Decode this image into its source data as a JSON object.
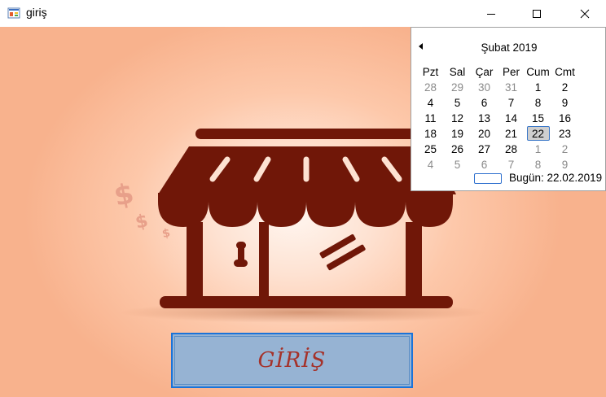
{
  "window": {
    "title": "giriş"
  },
  "login_button": {
    "label": "GİRİŞ"
  },
  "calendar": {
    "month_title": "Şubat 2019",
    "weekdays": [
      "Pzt",
      "Sal",
      "Çar",
      "Per",
      "Cum",
      "Cmt"
    ],
    "weeks": [
      [
        {
          "d": "28",
          "dim": true
        },
        {
          "d": "29",
          "dim": true
        },
        {
          "d": "30",
          "dim": true
        },
        {
          "d": "31",
          "dim": true
        },
        {
          "d": "1"
        },
        {
          "d": "2"
        }
      ],
      [
        {
          "d": "4"
        },
        {
          "d": "5"
        },
        {
          "d": "6"
        },
        {
          "d": "7"
        },
        {
          "d": "8"
        },
        {
          "d": "9"
        }
      ],
      [
        {
          "d": "11"
        },
        {
          "d": "12"
        },
        {
          "d": "13"
        },
        {
          "d": "14"
        },
        {
          "d": "15"
        },
        {
          "d": "16"
        }
      ],
      [
        {
          "d": "18"
        },
        {
          "d": "19"
        },
        {
          "d": "20"
        },
        {
          "d": "21"
        },
        {
          "d": "22",
          "selected": true
        },
        {
          "d": "23"
        }
      ],
      [
        {
          "d": "25"
        },
        {
          "d": "26"
        },
        {
          "d": "27"
        },
        {
          "d": "28"
        },
        {
          "d": "1",
          "dim": true
        },
        {
          "d": "2",
          "dim": true
        }
      ],
      [
        {
          "d": "4",
          "dim": true
        },
        {
          "d": "5",
          "dim": true
        },
        {
          "d": "6",
          "dim": true
        },
        {
          "d": "7",
          "dim": true
        },
        {
          "d": "8",
          "dim": true
        },
        {
          "d": "9",
          "dim": true
        }
      ]
    ],
    "today_label": "Bugün: 22.02.2019"
  },
  "colors": {
    "shop": "#701708",
    "dollar": "#e8a08a",
    "button_fill": "#96b3d3",
    "button_border": "#1a73d9",
    "button_text": "#a5322a"
  },
  "icons": [
    "app-icon",
    "minimize-icon",
    "maximize-icon",
    "close-icon",
    "prev-month-icon",
    "store-icon",
    "dollar-icon"
  ]
}
